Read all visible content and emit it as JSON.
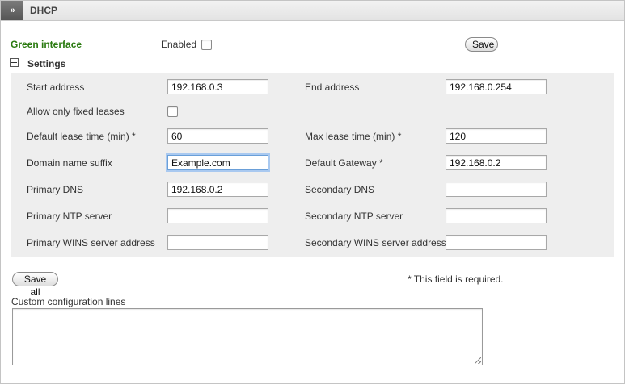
{
  "header": {
    "toggle_icon": "»",
    "title": "DHCP"
  },
  "interface": {
    "name": "Green interface",
    "enabled_label": "Enabled",
    "enabled": false,
    "save_label": "Save",
    "name_color": "#2a7a10"
  },
  "settings": {
    "section_label": "Settings",
    "start_address": {
      "label": "Start address",
      "value": "192.168.0.3"
    },
    "end_address": {
      "label": "End address",
      "value": "192.168.0.254"
    },
    "allow_fixed": {
      "label": "Allow only fixed leases",
      "checked": false
    },
    "default_lease": {
      "label": "Default lease time (min) *",
      "value": "60"
    },
    "max_lease": {
      "label": "Max lease time (min) *",
      "value": "120"
    },
    "domain_suffix": {
      "label": "Domain name suffix",
      "value": "Example.com"
    },
    "default_gateway": {
      "label": "Default Gateway *",
      "value": "192.168.0.2"
    },
    "primary_dns": {
      "label": "Primary DNS",
      "value": "192.168.0.2"
    },
    "secondary_dns": {
      "label": "Secondary DNS",
      "value": ""
    },
    "primary_ntp": {
      "label": "Primary NTP server",
      "value": ""
    },
    "secondary_ntp": {
      "label": "Secondary NTP server",
      "value": ""
    },
    "primary_wins": {
      "label": "Primary WINS server address",
      "value": ""
    },
    "secondary_wins": {
      "label": "Secondary WINS server address",
      "value": ""
    }
  },
  "footer": {
    "save_all_label": "Save all",
    "required_note": "* This field is required.",
    "custom_config_label": "Custom configuration lines",
    "custom_config_value": ""
  }
}
